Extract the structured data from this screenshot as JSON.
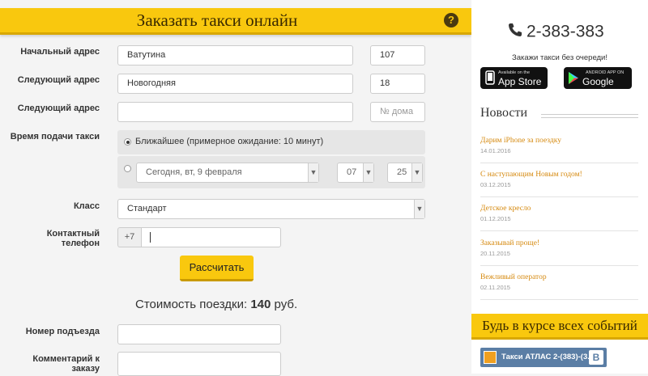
{
  "header": {
    "title": "Заказать такси онлайн",
    "help_icon": "?"
  },
  "form": {
    "start_label": "Начальный адрес",
    "start_street": "Ватутина",
    "start_house": "107",
    "next1_label": "Следующий адрес",
    "next1_street": "Новогодняя",
    "next1_house": "18",
    "next2_label": "Следующий адрес",
    "next2_street": "",
    "next2_house_placeholder": "№ дома",
    "time_label": "Время подачи такси",
    "time_option_nearest": "Ближайшее (примерное ожидание: 10 минут)",
    "date_value": "Сегодня, вт, 9 февраля",
    "hour_value": "07",
    "minute_value": "25",
    "class_label": "Класс",
    "class_value": "Стандарт",
    "phone_label": "Контактный телефон",
    "phone_prefix": "+7",
    "calc_button": "Рассчитать",
    "cost_prefix": "Стоимость поездки:",
    "cost_value": "140",
    "cost_unit": "руб.",
    "entrance_label": "Номер подъезда",
    "comment_label": "Комментарий к заказу"
  },
  "sidebar": {
    "phone": "2-383-383",
    "order_text": "Закажи такси без очереди!",
    "app_store": {
      "small": "Available on the",
      "big": "App Store"
    },
    "google_play": {
      "small": "ANDROID APP ON",
      "big": "Google play"
    },
    "news_title": "Новости",
    "news": [
      {
        "title": "Дарим iPhone за поездку",
        "date": "14.01.2016"
      },
      {
        "title": "С наступающим Новым годом!",
        "date": "03.12.2015"
      },
      {
        "title": "Детское кресло",
        "date": "01.12.2015"
      },
      {
        "title": "Заказывай проще!",
        "date": "20.11.2015"
      },
      {
        "title": "Вежливый оператор",
        "date": "02.11.2015"
      }
    ],
    "events_title": "Будь в курсе всех событий",
    "vk_text": "Такси АТЛАС 2-(383)-(3...",
    "vk_badge": "B"
  },
  "colors": {
    "accent": "#f9c80e",
    "news_link": "#d68a10",
    "vk": "#5b7ea5"
  },
  "icons": [
    "help-icon",
    "phone-icon",
    "apple-icon",
    "google-play-icon",
    "vk-icon",
    "chevron-down-icon"
  ]
}
